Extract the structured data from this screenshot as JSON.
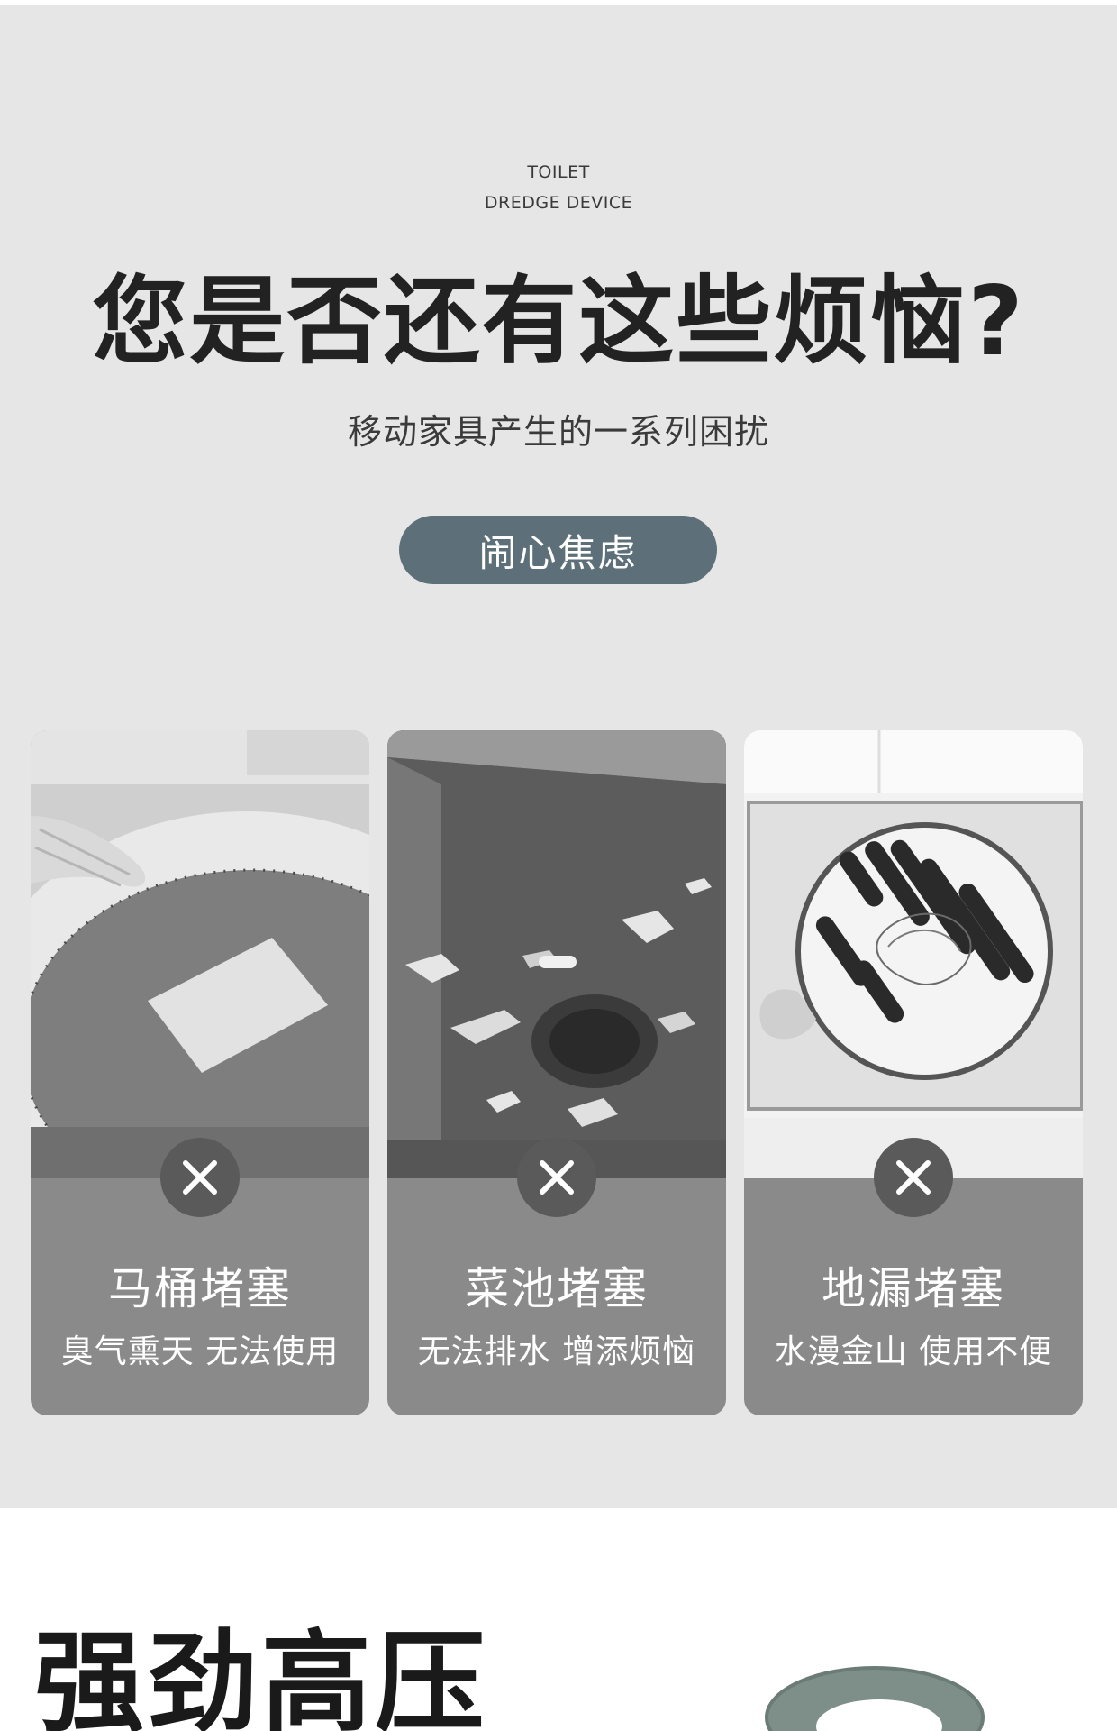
{
  "header": {
    "eyebrow_line1": "TOILET",
    "eyebrow_line2": "DREDGE DEVICE",
    "headline": "您是否还有这些烦恼?",
    "subline": "移动家具产生的一系列困扰",
    "pill_label": "闹心焦虑"
  },
  "cards": [
    {
      "title": "马桶堵塞",
      "desc": "臭气熏天 无法使用",
      "icon": "close-x-icon"
    },
    {
      "title": "菜池堵塞",
      "desc": "无法排水 增添烦恼",
      "icon": "close-x-icon"
    },
    {
      "title": "地漏堵塞",
      "desc": "水漫金山 使用不便",
      "icon": "close-x-icon"
    }
  ],
  "bottom": {
    "title": "强劲高压"
  },
  "colors": {
    "section_bg": "#e6e6e6",
    "pill_bg": "#5d7079",
    "card_bg": "#8a8a8a",
    "badge_bg": "#5a5a5a",
    "product_green": "#7d8f88"
  }
}
